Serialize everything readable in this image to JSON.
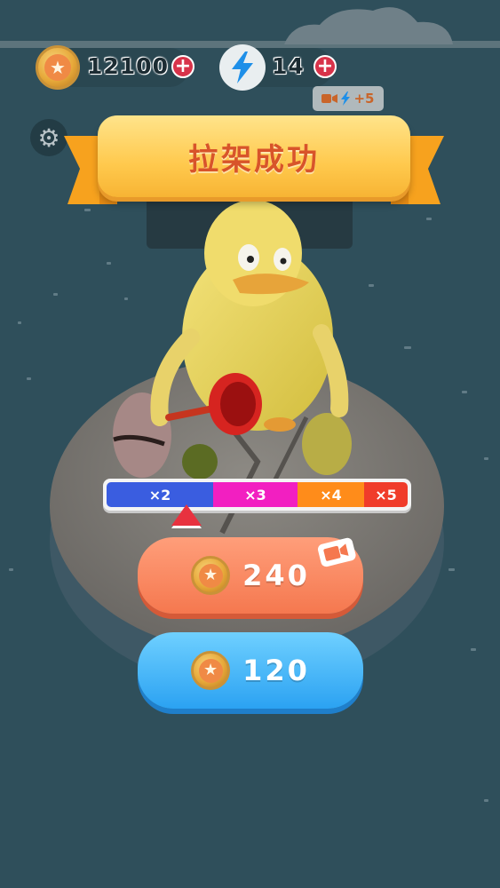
{
  "hud": {
    "coins": "12100",
    "coin_plus": "+",
    "energy": "14",
    "energy_plus": "+",
    "ad_bonus": "+5"
  },
  "banner": {
    "title": "拉架成功"
  },
  "multiplier": {
    "segments": [
      {
        "label": "×2",
        "color": "#3a5de0"
      },
      {
        "label": "×3",
        "color": "#f21fc1"
      },
      {
        "label": "×4",
        "color": "#ff8c1a"
      },
      {
        "label": "×5",
        "color": "#f03c2a"
      }
    ]
  },
  "buttons": {
    "ad_reward": "240",
    "plain_reward": "120"
  },
  "icons": {
    "coin": "star-coin-icon",
    "energy": "lightning-icon",
    "settings": "gear-icon",
    "video": "video-camera-icon"
  }
}
